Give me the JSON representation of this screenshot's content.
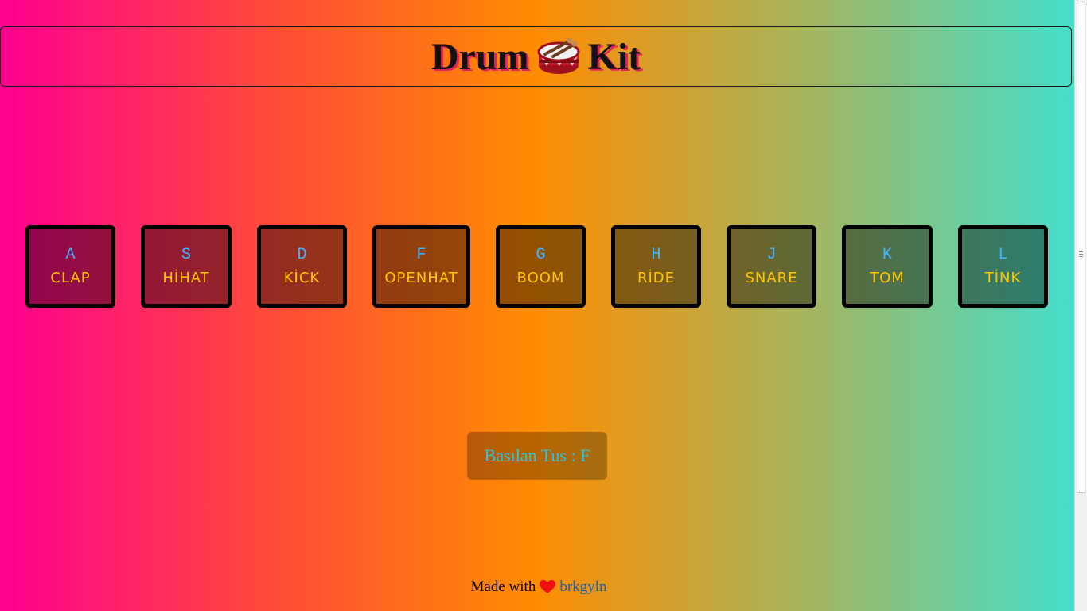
{
  "header": {
    "title_left": "Drum",
    "title_right": "Kit",
    "icon": "drum-icon"
  },
  "keys": [
    {
      "letter": "A",
      "sound": "CLAP"
    },
    {
      "letter": "S",
      "sound": "HİHAT"
    },
    {
      "letter": "D",
      "sound": "KİCK"
    },
    {
      "letter": "F",
      "sound": "OPENHAT"
    },
    {
      "letter": "G",
      "sound": "BOOM"
    },
    {
      "letter": "H",
      "sound": "RİDE"
    },
    {
      "letter": "J",
      "sound": "SNARE"
    },
    {
      "letter": "K",
      "sound": "TOM"
    },
    {
      "letter": "L",
      "sound": "TİNK"
    }
  ],
  "pressed": {
    "text": "Basılan Tus : F"
  },
  "footer": {
    "made_with": "Made with",
    "icon": "heart-icon",
    "author": "brkgyln"
  },
  "colors": {
    "gradient": [
      "#ff0090",
      "#ff8c00",
      "#40e0d0"
    ],
    "key_letter": "#3fb6ff",
    "key_sound": "#ffc600",
    "pressed_text": "#23c8f0",
    "heart": "#ee1111"
  }
}
